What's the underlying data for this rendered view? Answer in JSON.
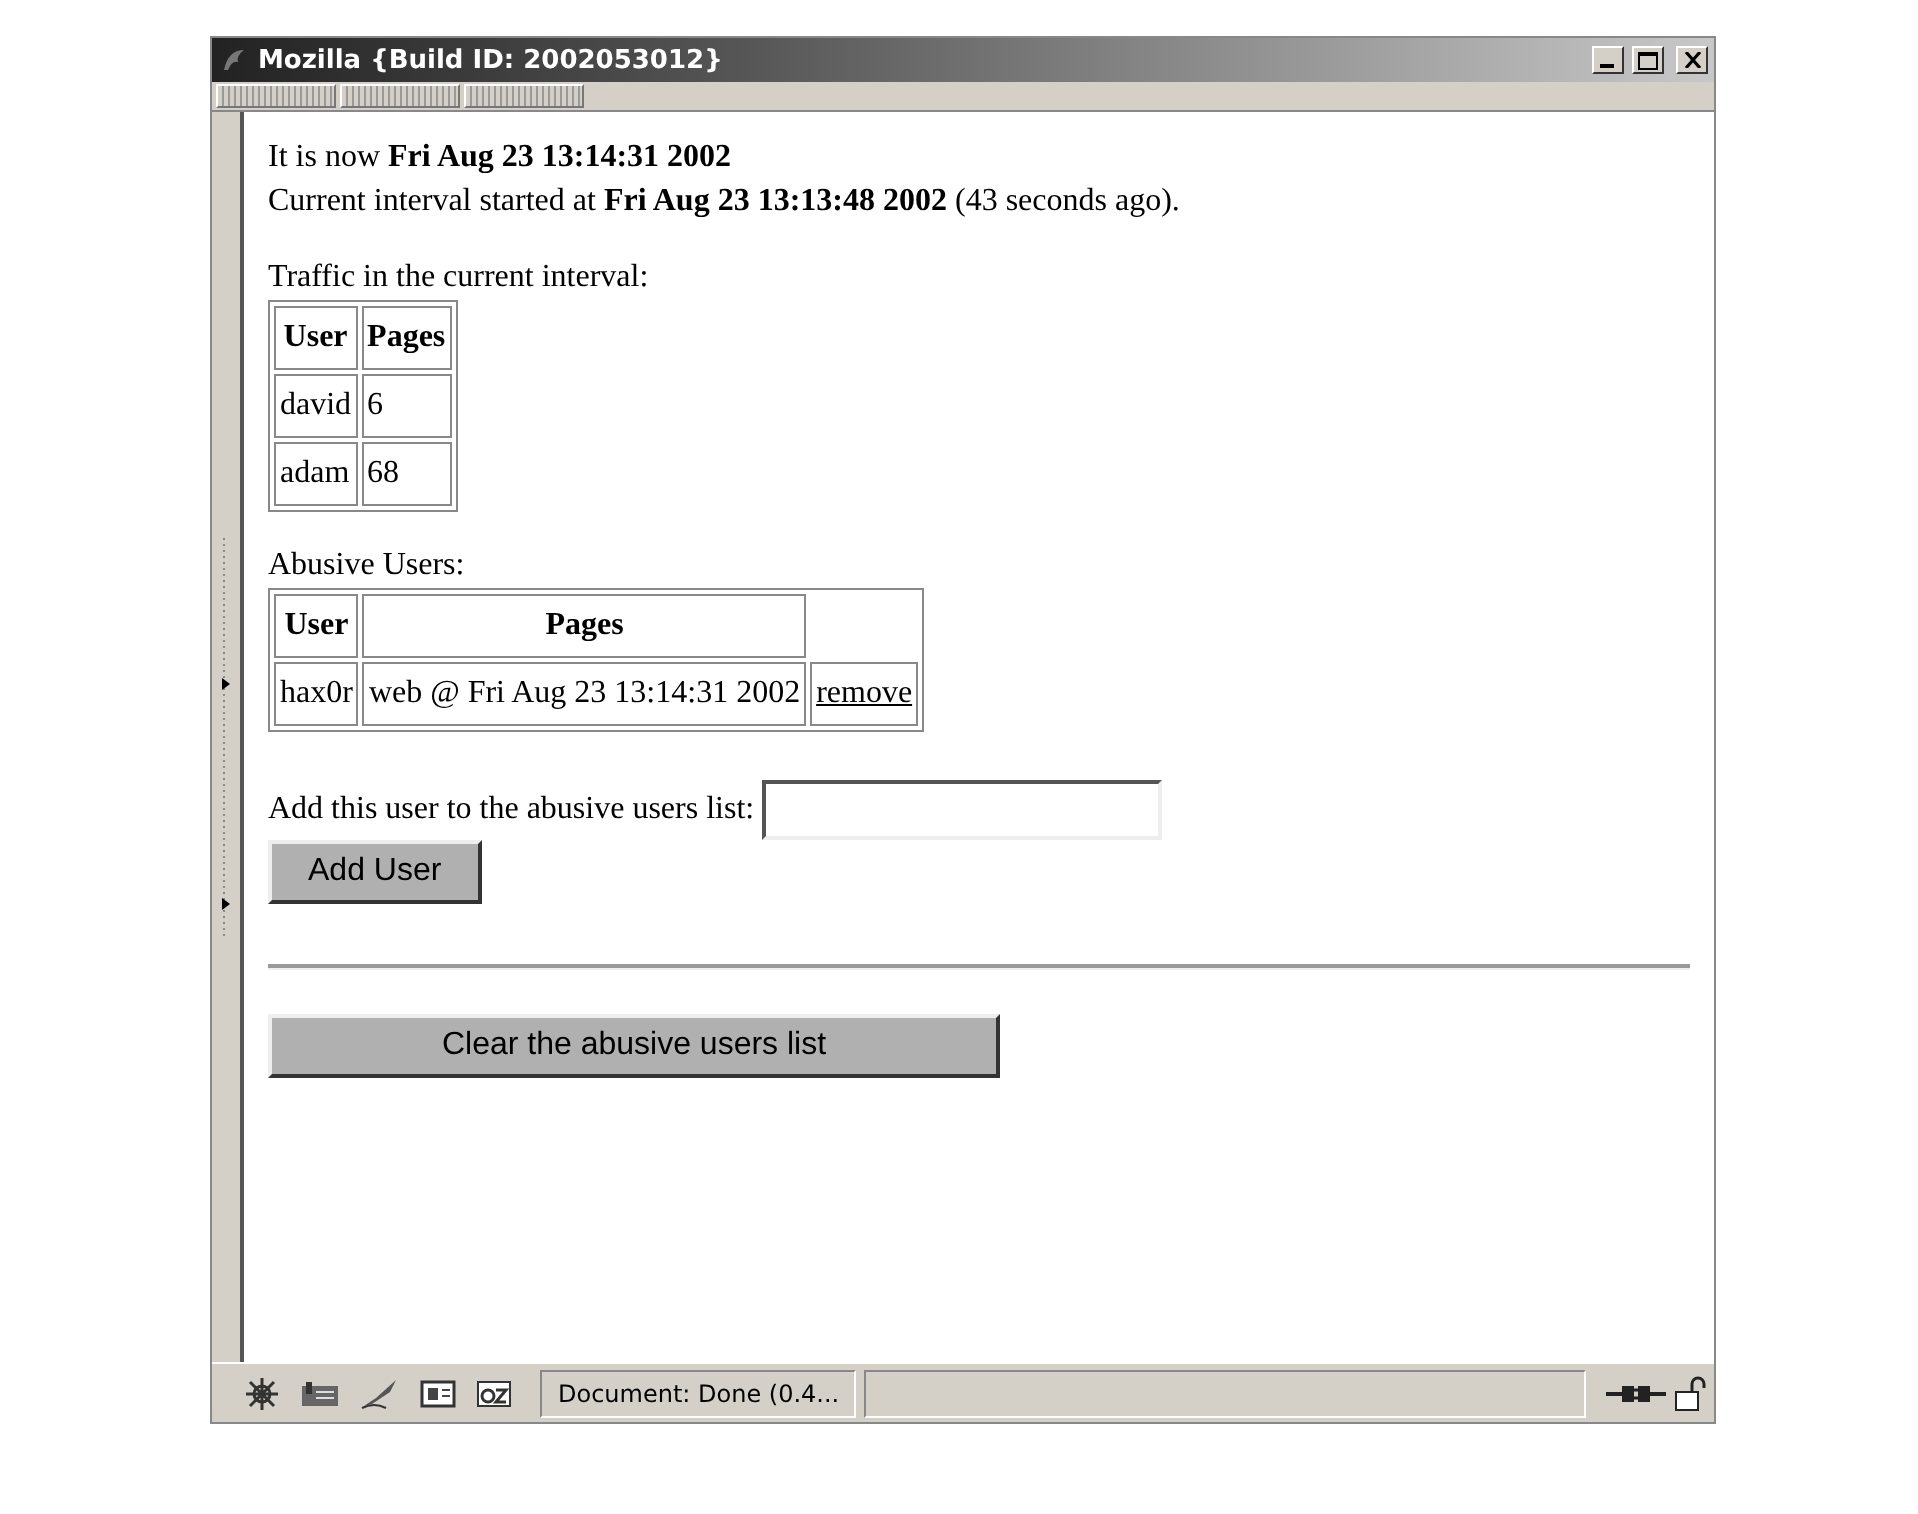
{
  "window": {
    "title": "Mozilla {Build ID: 2002053012}"
  },
  "content": {
    "now_line": "It is now **Fri Aug 23 13:14:31 2002**",
    "interval_line": "Current interval started at **Fri Aug 23 13:13:48 2002** (43 seconds ago).",
    "traffic": {
      "caption": "Traffic in the current interval:",
      "columns": [
        "User",
        "Pages"
      ],
      "rows": [
        [
          "david",
          "6"
        ],
        [
          "adam",
          "68"
        ]
      ]
    },
    "abusive": {
      "caption": "Abusive Users:",
      "columns": [
        "User",
        "Pages"
      ],
      "rows": [
        {
          "user": "hax0r",
          "pages": "web @ Fri Aug 23 13:14:31 2002",
          "action": "remove"
        }
      ]
    },
    "add_form": {
      "label": "Add this user to the abusive users list:",
      "button": "Add User"
    },
    "clear_button": "Clear the abusive users list"
  },
  "status_bar": {
    "text": "Document: Done (0.4..."
  }
}
